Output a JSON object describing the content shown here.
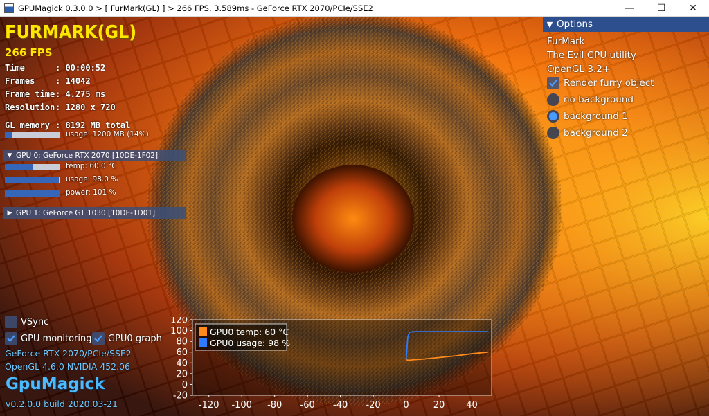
{
  "window": {
    "title": "GPUMagick 0.3.0.0 > [ FurMark(GL) ] > 266 FPS, 3.589ms - GeForce RTX 2070/PCIe/SSE2",
    "minimize_glyph": "—",
    "maximize_glyph": "☐",
    "close_glyph": "✕"
  },
  "hud": {
    "logo": "FURMARK(GL)",
    "fps": "266 FPS",
    "stats": [
      {
        "label": "Time",
        "value": ": 00:00:52"
      },
      {
        "label": "Frames",
        "value": ": 14042"
      },
      {
        "label": "Frame time",
        "value": ": 4.275 ms"
      },
      {
        "label": "Resolution",
        "value": ": 1280 x 720"
      }
    ],
    "memory": {
      "label": "GL memory",
      "value": ": 8192 MB total",
      "usage_text": "usage: 1200 MB (14%)",
      "usage_fraction": 0.14
    }
  },
  "gpus": [
    {
      "header": "GPU 0: GeForce RTX 2070 [10DE-1F02]",
      "expanded": true,
      "metrics": [
        {
          "text": "temp: 60.0 °C",
          "fraction": 0.5
        },
        {
          "text": "usage: 98.0 %",
          "fraction": 0.98
        },
        {
          "text": "power: 101 %",
          "fraction": 1.0
        }
      ]
    },
    {
      "header": "GPU 1: GeForce GT 1030 [10DE-1D01]",
      "expanded": false
    }
  ],
  "options": {
    "header": "Options",
    "info": [
      "FurMark",
      "The Evil GPU utility",
      "OpenGL 3.2+"
    ],
    "render_furry": {
      "label": "Render furry object",
      "checked": true
    },
    "backgrounds": [
      {
        "label": "no background",
        "selected": false
      },
      {
        "label": "background 1",
        "selected": true
      },
      {
        "label": "background 2",
        "selected": false
      }
    ]
  },
  "bottom": {
    "vsync": {
      "label": "VSync",
      "checked": false
    },
    "gpu_monitoring": {
      "label": "GPU monitoring",
      "checked": true
    },
    "gpu0_graph": {
      "label": "GPU0 graph",
      "checked": true
    },
    "renderer": "GeForce RTX 2070/PCIe/SSE2",
    "gl_version": "OpenGL 4.6.0 NVIDIA 452.06",
    "brand": "GpuMagick",
    "build": "v0.2.0.0 build 2020.03-21"
  },
  "chart_data": {
    "type": "line",
    "title": "",
    "xlabel": "",
    "ylabel": "",
    "xlim": [
      -130,
      52
    ],
    "ylim": [
      -20,
      120
    ],
    "x_ticks": [
      -120,
      -100,
      -80,
      -60,
      -40,
      -20,
      0,
      20,
      40
    ],
    "y_ticks": [
      120,
      100,
      80,
      60,
      40,
      20,
      0,
      -20
    ],
    "legend_position": "top-left",
    "grid": false,
    "series": [
      {
        "name": "GPU0 temp: 60 °C",
        "color": "#ff8a1a",
        "x": [
          0,
          1,
          2,
          5,
          10,
          20,
          30,
          40,
          50
        ],
        "y": [
          46,
          45,
          45,
          46,
          47,
          50,
          53,
          57,
          60
        ]
      },
      {
        "name": "GPU0 usage: 98 %",
        "color": "#2d7bff",
        "x": [
          0,
          1,
          2,
          5,
          10,
          20,
          30,
          40,
          50
        ],
        "y": [
          46,
          88,
          97,
          98,
          98,
          98,
          98,
          98,
          98
        ]
      }
    ]
  }
}
